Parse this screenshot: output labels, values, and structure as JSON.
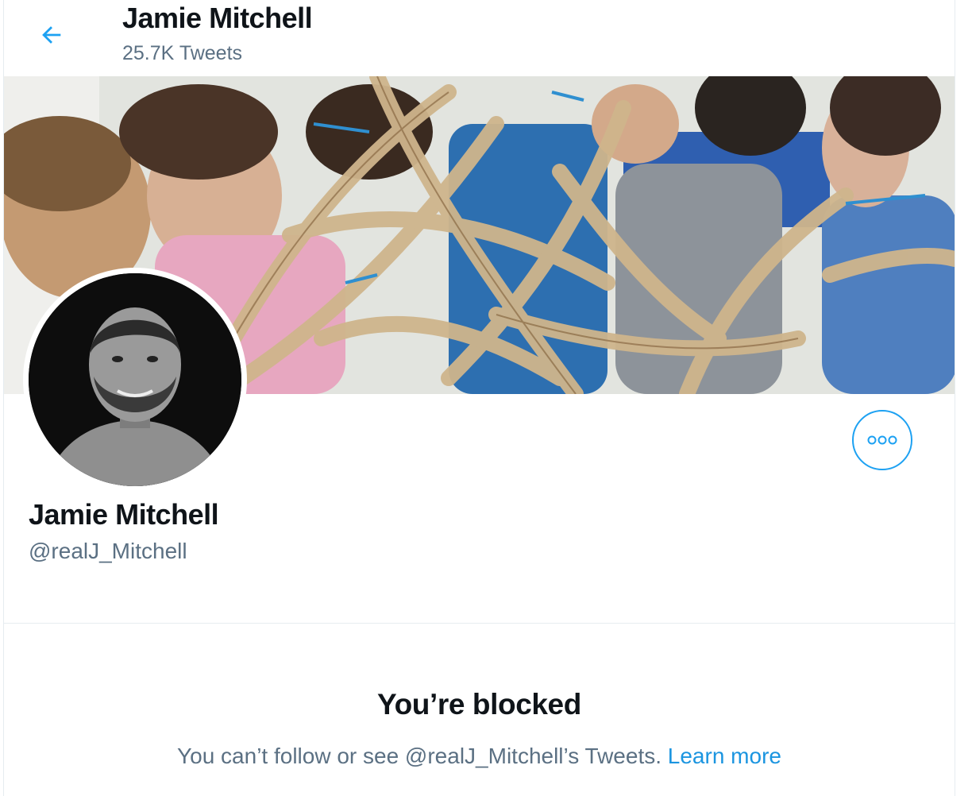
{
  "header": {
    "title": "Jamie Mitchell",
    "tweet_count": "25.7K Tweets"
  },
  "profile": {
    "name": "Jamie Mitchell",
    "handle": "@realJ_Mitchell"
  },
  "blocked": {
    "title": "You’re blocked",
    "message": "You can’t follow or see @realJ_Mitchell’s Tweets.",
    "learn_more": "Learn more"
  },
  "icons": {
    "back": "back-arrow-icon",
    "more": "more-options-icon"
  },
  "colors": {
    "accent": "#1da1f2",
    "link": "#1b95e0",
    "secondary_text": "#5b7083"
  }
}
